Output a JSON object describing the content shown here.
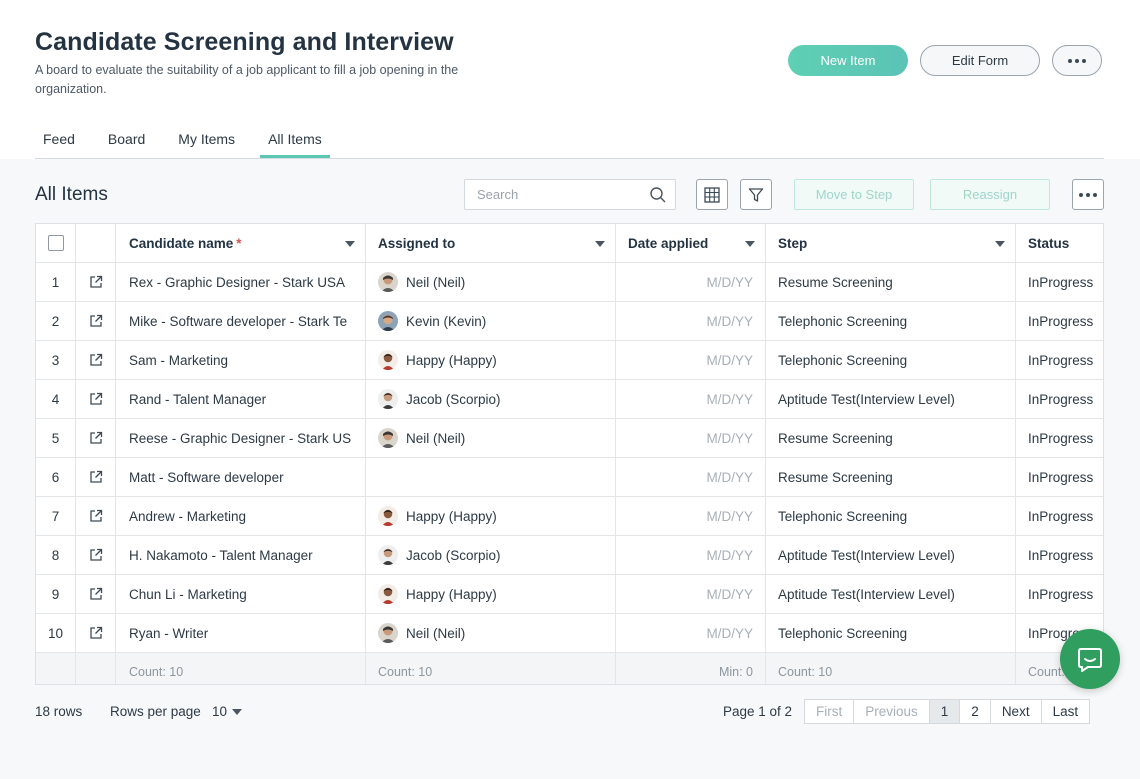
{
  "header": {
    "title": "Candidate Screening and Interview",
    "description": "A board to evaluate the suitability of a job applicant to fill a job opening in the organization.",
    "new_item": "New Item",
    "edit_form": "Edit Form"
  },
  "tabs": [
    {
      "label": "Feed"
    },
    {
      "label": "Board"
    },
    {
      "label": "My Items"
    },
    {
      "label": "All Items",
      "active": true
    }
  ],
  "toolbar": {
    "section_title": "All Items",
    "search_placeholder": "Search",
    "move_to_step": "Move to Step",
    "reassign": "Reassign"
  },
  "columns": {
    "name": "Candidate name",
    "required_mark": "*",
    "assigned": "Assigned to",
    "date": "Date applied",
    "step": "Step",
    "status": "Status"
  },
  "rows": [
    {
      "n": "1",
      "name": "Rex - Graphic Designer - Stark USA",
      "assigned": "Neil (Neil)",
      "avatar": "neil",
      "date": "M/D/YY",
      "step": "Resume Screening",
      "status": "InProgress"
    },
    {
      "n": "2",
      "name": "Mike - Software developer - Stark Te",
      "assigned": "Kevin (Kevin)",
      "avatar": "kevin",
      "date": "M/D/YY",
      "step": "Telephonic Screening",
      "status": "InProgress"
    },
    {
      "n": "3",
      "name": "Sam - Marketing",
      "assigned": "Happy (Happy)",
      "avatar": "happy",
      "date": "M/D/YY",
      "step": "Telephonic Screening",
      "status": "InProgress"
    },
    {
      "n": "4",
      "name": "Rand - Talent Manager",
      "assigned": "Jacob (Scorpio)",
      "avatar": "jacob",
      "date": "M/D/YY",
      "step": "Aptitude Test(Interview Level)",
      "status": "InProgress"
    },
    {
      "n": "5",
      "name": "Reese - Graphic Designer - Stark US",
      "assigned": "Neil (Neil)",
      "avatar": "neil",
      "date": "M/D/YY",
      "step": "Resume Screening",
      "status": "InProgress"
    },
    {
      "n": "6",
      "name": "Matt - Software developer",
      "assigned": "",
      "avatar": "",
      "date": "M/D/YY",
      "step": "Resume Screening",
      "status": "InProgress"
    },
    {
      "n": "7",
      "name": "Andrew - Marketing",
      "assigned": "Happy (Happy)",
      "avatar": "happy",
      "date": "M/D/YY",
      "step": "Telephonic Screening",
      "status": "InProgress"
    },
    {
      "n": "8",
      "name": "H. Nakamoto - Talent Manager",
      "assigned": "Jacob (Scorpio)",
      "avatar": "jacob",
      "date": "M/D/YY",
      "step": "Aptitude Test(Interview Level)",
      "status": "InProgress"
    },
    {
      "n": "9",
      "name": "Chun Li - Marketing",
      "assigned": "Happy (Happy)",
      "avatar": "happy",
      "date": "M/D/YY",
      "step": "Aptitude Test(Interview Level)",
      "status": "InProgress"
    },
    {
      "n": "10",
      "name": "Ryan - Writer",
      "assigned": "Neil (Neil)",
      "avatar": "neil",
      "date": "M/D/YY",
      "step": "Telephonic Screening",
      "status": "InProgress"
    }
  ],
  "footer": {
    "name": "Count: 10",
    "assigned": "Count: 10",
    "date": "Min: 0",
    "step": "Count: 10",
    "status": "Count: 10"
  },
  "pager": {
    "rows_count": "18 rows",
    "rows_per_page_label": "Rows per page",
    "rows_per_page": "10",
    "page_info": "Page 1 of 2",
    "first": "First",
    "previous": "Previous",
    "pages": [
      "1",
      "2"
    ],
    "current_page": "1",
    "next": "Next",
    "last": "Last"
  },
  "colors": {
    "accent": "#5cc7b2",
    "chat": "#2f9e5e"
  }
}
